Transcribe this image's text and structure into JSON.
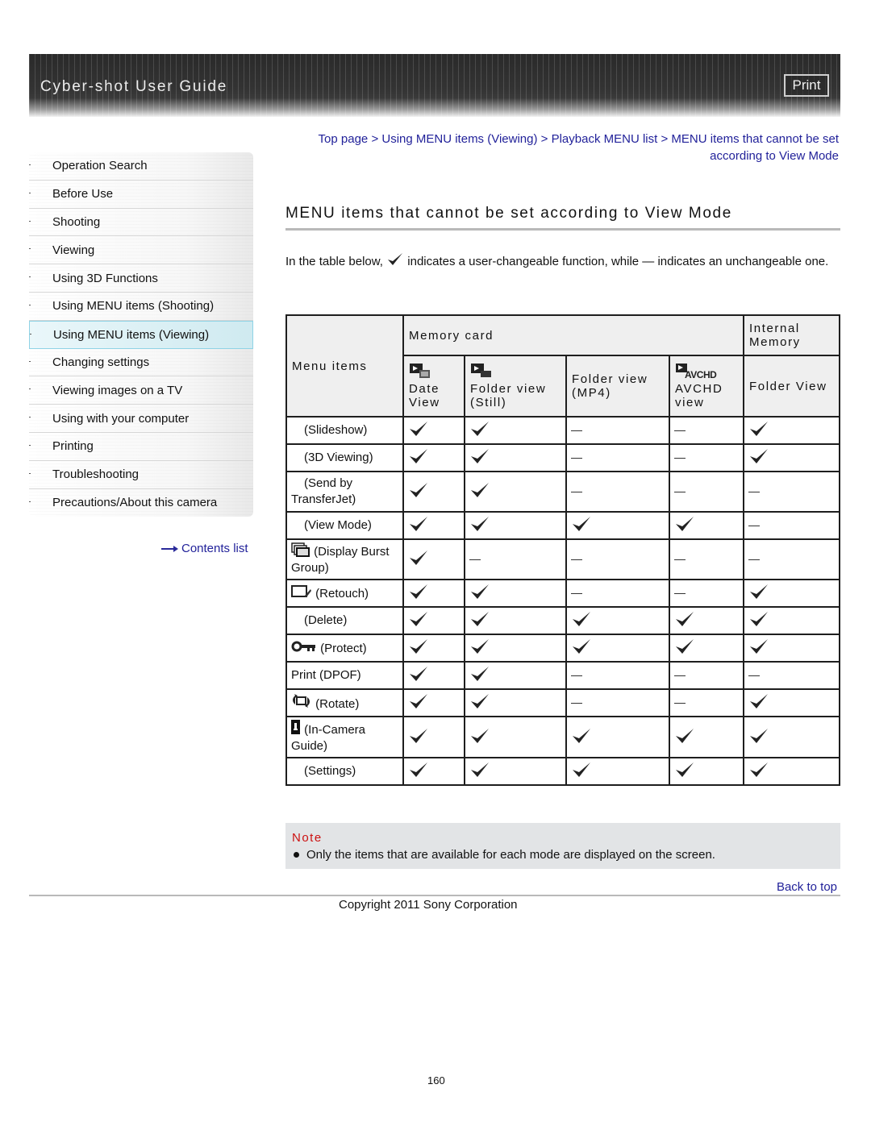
{
  "header": {
    "title": "Cyber-shot User Guide",
    "print_label": "Print"
  },
  "sidebar": {
    "items": [
      {
        "label": "Operation Search",
        "active": false
      },
      {
        "label": "Before Use",
        "active": false
      },
      {
        "label": "Shooting",
        "active": false
      },
      {
        "label": "Viewing",
        "active": false
      },
      {
        "label": "Using 3D Functions",
        "active": false
      },
      {
        "label": "Using MENU items (Shooting)",
        "active": false
      },
      {
        "label": "Using MENU items (Viewing)",
        "active": true
      },
      {
        "label": "Changing settings",
        "active": false
      },
      {
        "label": "Viewing images on a TV",
        "active": false
      },
      {
        "label": "Using with your computer",
        "active": false
      },
      {
        "label": "Printing",
        "active": false
      },
      {
        "label": "Troubleshooting",
        "active": false
      },
      {
        "label": "Precautions/About this camera",
        "active": false
      }
    ],
    "contents_list_label": "Contents list"
  },
  "breadcrumb": {
    "items": [
      "Top page",
      "Using MENU items (Viewing)",
      "Playback MENU list",
      "MENU items that cannot be set according to View Mode"
    ],
    "separator": ">"
  },
  "page": {
    "title": "MENU items that cannot be set according to View Mode",
    "intro_before": "In the table below,",
    "intro_after": "indicates a user-changeable function, while — indicates an unchangeable one."
  },
  "table": {
    "header_menu_items": "Menu items",
    "header_memory_card": "Memory card",
    "header_internal_memory": "Internal Memory",
    "columns": [
      {
        "label": "Date View",
        "icon": "date-view-icon"
      },
      {
        "label": "Folder view (Still)",
        "icon": "folder-view-still-icon"
      },
      {
        "label": "Folder view (MP4)",
        "icon": ""
      },
      {
        "label": "AVCHD view",
        "icon": "avchd-view-icon"
      },
      {
        "label": "Folder View",
        "icon": ""
      }
    ],
    "legend": {
      "check": "✓ user-changeable",
      "dash": "— unchangeable"
    },
    "rows": [
      {
        "label": "(Slideshow)",
        "icon": "slideshow-icon",
        "values": [
          "check",
          "check",
          "dash",
          "dash",
          "check"
        ]
      },
      {
        "label": "(3D Viewing)",
        "icon": "3d-viewing-icon",
        "values": [
          "check",
          "check",
          "dash",
          "dash",
          "check"
        ]
      },
      {
        "label": "(Send by TransferJet)",
        "icon": "transferjet-icon",
        "values": [
          "check",
          "check",
          "dash",
          "dash",
          "dash"
        ]
      },
      {
        "label": "(View Mode)",
        "icon": "view-mode-icon",
        "values": [
          "check",
          "check",
          "check",
          "check",
          "dash"
        ]
      },
      {
        "label": "(Display Burst Group)",
        "icon": "burst-group-icon",
        "values": [
          "check",
          "dash",
          "dash",
          "dash",
          "dash"
        ]
      },
      {
        "label": "(Retouch)",
        "icon": "retouch-icon",
        "values": [
          "check",
          "check",
          "dash",
          "dash",
          "check"
        ]
      },
      {
        "label": "(Delete)",
        "icon": "delete-icon",
        "values": [
          "check",
          "check",
          "check",
          "check",
          "check"
        ]
      },
      {
        "label": "(Protect)",
        "icon": "protect-key-icon",
        "values": [
          "check",
          "check",
          "check",
          "check",
          "check"
        ]
      },
      {
        "label": "Print (DPOF)",
        "icon": "",
        "values": [
          "check",
          "check",
          "dash",
          "dash",
          "dash"
        ]
      },
      {
        "label": "(Rotate)",
        "icon": "rotate-icon",
        "values": [
          "check",
          "check",
          "dash",
          "dash",
          "check"
        ]
      },
      {
        "label": "(In-Camera Guide)",
        "icon": "in-camera-guide-icon",
        "values": [
          "check",
          "check",
          "check",
          "check",
          "check"
        ]
      },
      {
        "label": "(Settings)",
        "icon": "settings-icon",
        "values": [
          "check",
          "check",
          "check",
          "check",
          "check"
        ]
      }
    ]
  },
  "note": {
    "title": "Note",
    "items": [
      "Only the items that are available for each mode are displayed on the screen."
    ]
  },
  "footer": {
    "back_to_top": "Back to top",
    "copyright": "Copyright 2011 Sony Corporation",
    "page_number": "160"
  },
  "colors": {
    "link": "#22229a",
    "note_title": "#cc1111",
    "note_bg": "#e2e4e6",
    "active_nav": "#cfeaf0"
  }
}
